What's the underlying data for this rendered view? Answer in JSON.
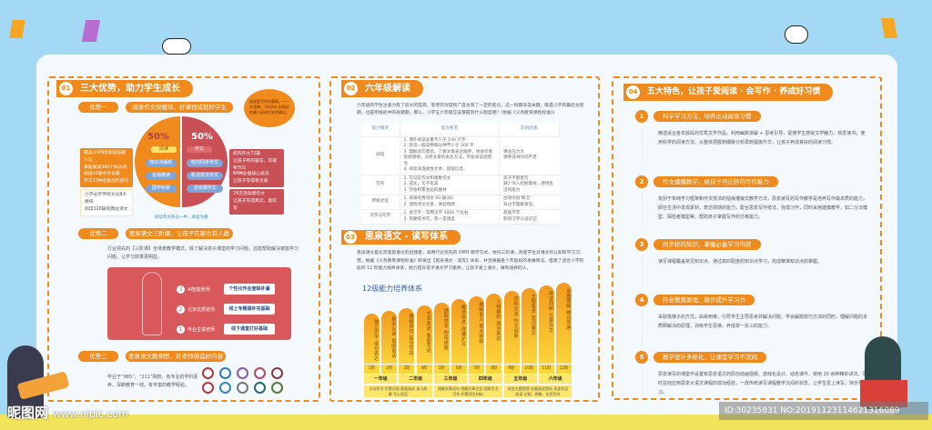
{
  "s1": {
    "num": "01",
    "title": "三大优势，助力学生成长",
    "adv1": {
      "label": "优势一",
      "title": "阅读作文双模块，好课程成就好学生"
    },
    "quote": "阅读是写作的基础。——叶圣陶，1942年 由阅读的输入促进作文的输出。",
    "read": {
      "pct": "50%",
      "label": "阅读",
      "tags": [
        "知识点解析",
        "名篇精读",
        "国学积累"
      ]
    },
    "write": {
      "pct": "50%",
      "label": "作文",
      "tags": [
        "校内同步作文",
        "新话技法作文",
        "活动课作文"
      ]
    },
    "left_boxes": [
      [
        "覆盖小学6年阅读答题方法",
        "掌握阅读300个知识点"
      ],
      [
        "阅读42篇中外名篇",
        "学习22种名家创作技巧"
      ],
      [
        "小学必学传统文化8大模块",
        "阅读126篇经典古诗文"
      ]
    ],
    "right_boxes": [
      [
        "校内作文72篇",
        "让孩子有内容写，写得有自信"
      ],
      [
        "84种必备核心技法",
        "让孩子写得有文采"
      ],
      [
        "24次活动课作文",
        "让孩子写得真实，喜欢写"
      ]
    ],
    "caption": "阅读作文各占一半，阅读为重",
    "adv2": {
      "label": "优势二",
      "title": "思泉语文三阶课，让孩子在家也有人教",
      "text": "行业领先的【三阶课】全场景教学模式，除了解决孩子课堂的学习问题，还能帮助解决家庭学习问题，让学习效果更明显。"
    },
    "rocket": [
      {
        "n": "3",
        "teacher": "AI智能老师",
        "desc": "个性化作业查缺补漏"
      },
      {
        "n": "2",
        "teacher": "北京优质老师",
        "desc": "线上专题课补充基础"
      },
      {
        "n": "1",
        "teacher": "专业主讲老师",
        "desc": "线下课堂打好基础"
      }
    ],
    "adv3": {
      "label": "优势三",
      "title": "思泉语文教师团，好老师缔造好内容",
      "text": "毕业于“985”、“211”院校，有专业的学科素养，深耕教育一线，有丰富的教学经验。"
    }
  },
  "s2": {
    "num": "02",
    "title": "六年级解读",
    "intro": "六年级的学生注意力有了较大的提高，思考的深度和广度也有了一定的变化，这一时期非常关键，既是小学的最后总结期，也是衔接初中的关键期。那么，小学五六年级应该掌握到什么程度呢？(依据《义务教育课程标准》)",
    "headers": [
      "能力模块",
      "能力要求",
      "影响因素"
    ],
    "rows": [
      {
        "module": "阅读",
        "req": [
          "1. 课外阅读总量不少于 100 万字",
          "2. 默读一般读物每分钟不少于 300 字",
          "3. 理解词句意思，了解文章表达顺序，体会作者思想感情，分析文章的表达方法，学会阅读说明文",
          "4. 阅读非连续性文本，提取信息"
        ],
        "factor": [
          "课业压力大",
          "课余读书时间不足"
        ]
      },
      {
        "module": "写作",
        "req": [
          "1. 写记实作文和想象作文",
          "2. 成文，句子优美",
          "3. 学会积累身边的素材"
        ],
        "factor": [
          "孩子不愿意写",
          "缺少深入挖掘素材，感悟生活的能力"
        ]
      },
      {
        "module": "传统文化",
        "req": [
          "1. 背诵优秀诗文 60 篇(段)",
          "2. 领悟诗文大意，体验情感"
        ],
        "factor": [
          "古诗文很'晦涩'",
          "背过不理解意思。"
        ]
      },
      {
        "module": "识字与写字",
        "req": [
          "1. 会写字：常用汉字 3000 个左右",
          "2. 有硬笔书写，有一定速度"
        ],
        "factor": [
          "基础不牢",
          "影响汉字认读识记"
        ]
      }
    ]
  },
  "s3": {
    "num": "03",
    "title": "思泉语文 - 读写体系",
    "intro": "思泉语文是北京高思语文的创建者，采用行业领先的 OMO 教学方式，依托三阶课，改变学生对语文的认知和学习习惯。根据《义务教育课程标准》研发出【思泉语文 - 读写】体系，并且根据各个年龄段的发展情况，搭建了适合小学阶段的 12 阶能力培养体系，助力提升孩子语文学习素养，让孩子爱上语文，做有培养的人。",
    "chart_title": "12级能力培养体系"
  },
  "chart_data": {
    "type": "bar",
    "title": "12级能力培养体系",
    "categories": [
      "1阶",
      "2阶",
      "3阶",
      "4阶",
      "5阶",
      "6阶",
      "7阶",
      "8阶",
      "9阶",
      "10阶",
      "11阶",
      "12阶"
    ],
    "labels": [
      "独立识字 成句表达",
      "基本认读 看图说话",
      "理解词句 连句写段",
      "文本复述 看图写话",
      "提取信息 构段成篇",
      "概括信息 改编扩写",
      "理解含义 观点修辞",
      "人物解析 观点表达",
      "赏析文本 作文创新",
      "主题鉴赏 赏词美文",
      "辨证判断 立意升华",
      "全面理解 融合贯通"
    ],
    "values": [
      1,
      2,
      3,
      4,
      5,
      6,
      7,
      8,
      9,
      10,
      11,
      12
    ],
    "grades": [
      "一年级",
      "二年级",
      "三年级",
      "四年级",
      "五年级",
      "六年级"
    ],
    "grade_desc": [
      "主动识字 积累词语 图画阅读 读小故事 写心里话",
      "理解文章语句 把握文章主旨 观察生活写作 积累语言材料",
      "体会主题思想 名著阅读赏析 多类作品阅读 记叙、想象、应用写作"
    ]
  },
  "s4": {
    "num": "04",
    "title": "五大特色，让孩子爱阅读 · 会写作 · 养成好习惯",
    "items": [
      {
        "n": "1",
        "title": "科学学习方法，培养主动阅读习惯",
        "text": "精选适合各年龄段的优秀文学作品，利用幽默讲解 + 思考引导，促使学生感受文学魅力，热爱读书；使用科学的阅读方法，从整体把握到细致分析再到提炼升华，让孩子养成良好的阅读习惯。"
      },
      {
        "n": "2",
        "title": "作文建模教学，给孩子可迁移的写作能力",
        "text": "有别于单纯学习框架和作文技法的枯燥灌输式教学方法，思泉读写的写作教学是培养写作最本质的能力，即在生活中发现素材，表达情感的能力，配合思泉写作技法，完成习作，同时采用建模教学，如二分法模型、探险者模型等，帮助孩子掌握写作的迁移能力。"
      },
      {
        "n": "3",
        "title": "同步校内知识，掌握必备学习内容",
        "text": "读写课程覆盖常见知识点，通过高匹配度的知识点学习，完成精准知识点的掌握。"
      },
      {
        "n": "4",
        "title": "符合教育原理，稳步提升学习力",
        "text": "采取搭梯子的方式，由易到难，引导学生主导思考并解决问题，学会解题技巧方法的同时，理解问题的本质即解决的原理，训练学生思维，养成举一反三的能力。"
      },
      {
        "n": "5",
        "title": "教学设计多样化，让课堂学习不沉闷",
        "text": "思泉读写的课堂中设置有思泉语文的原创动画视频、游戏化设计、动态课件，使用 20 余种精彩讲法，同时总结应用思泉大语文课程的成功经验，一改传统读写课程教学沉闷的状态，让学生爱上读写，快乐学习。"
      }
    ]
  },
  "watermark": {
    "logo": "昵图网",
    "site": "www.nipic.com",
    "id": "ID:30235831 NO:20191123114621316089"
  },
  "colors": {
    "orange": "#f08a1c",
    "sky": "#a3d9f5",
    "red": "#d9585b",
    "yellow": "#fbd43a"
  }
}
